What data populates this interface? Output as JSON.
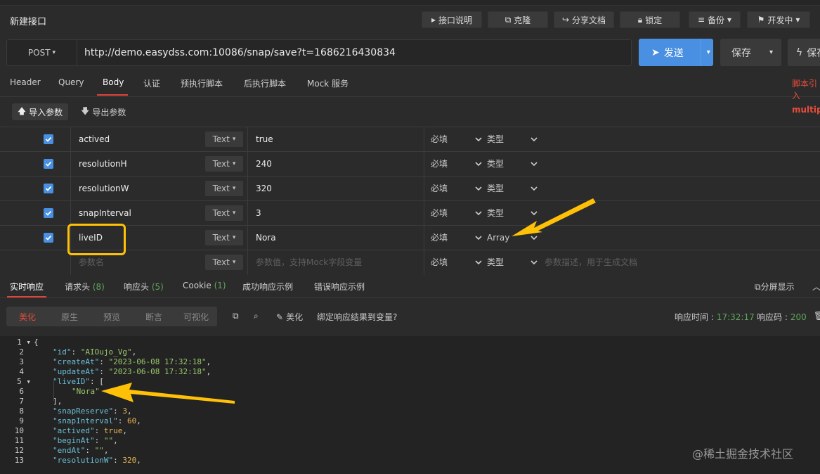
{
  "header": {
    "title": "新建接口",
    "toolbar": [
      {
        "label": "接口说明",
        "icon": "play-icon"
      },
      {
        "label": "克隆",
        "icon": "copy-icon"
      },
      {
        "label": "分享文档",
        "icon": "share-icon"
      },
      {
        "label": "锁定",
        "icon": "lock-icon"
      },
      {
        "label": "备份",
        "icon": "database-icon"
      },
      {
        "label": "开发中",
        "icon": "flag-icon"
      }
    ]
  },
  "request": {
    "method": "POST",
    "url": "http://demo.easydss.com:10086/snap/save?t=1686216430834",
    "send_label": "发送",
    "save_label": "保存",
    "save2_label": "保存"
  },
  "tabs": [
    "Header",
    "Query",
    "Body",
    "认证",
    "预执行脚本",
    "后执行脚本",
    "Mock 服务"
  ],
  "active_tab": "Body",
  "tabs_right_note": "脚本引入",
  "body": {
    "import_label": "导入参数",
    "export_label": "导出参数",
    "mode": "multipart",
    "rows": [
      {
        "name": "actived",
        "type": "Text",
        "value": "true",
        "required": "必填",
        "dtype": "类型"
      },
      {
        "name": "resolutionH",
        "type": "Text",
        "value": "240",
        "required": "必填",
        "dtype": "类型"
      },
      {
        "name": "resolutionW",
        "type": "Text",
        "value": "320",
        "required": "必填",
        "dtype": "类型"
      },
      {
        "name": "snapInterval",
        "type": "Text",
        "value": "3",
        "required": "必填",
        "dtype": "类型"
      },
      {
        "name": "liveID",
        "type": "Text",
        "value": "Nora",
        "required": "必填",
        "dtype": "Array"
      }
    ],
    "new_row": {
      "name_placeholder": "参数名",
      "type": "Text",
      "value_placeholder": "参数值，支持Mock字段变量",
      "required": "必填",
      "dtype": "类型",
      "desc_placeholder": "参数描述，用于生成文档"
    }
  },
  "response": {
    "tabs": [
      {
        "label": "实时响应",
        "count": ""
      },
      {
        "label": "请求头",
        "count": "(8)"
      },
      {
        "label": "响应头",
        "count": "(5)"
      },
      {
        "label": "Cookie",
        "count": "(1)"
      },
      {
        "label": "成功响应示例",
        "count": ""
      },
      {
        "label": "错误响应示例",
        "count": ""
      }
    ],
    "split_label": "分屏显示",
    "views": [
      "美化",
      "原生",
      "预览",
      "断言",
      "可视化"
    ],
    "active_view": "美化",
    "beautify_label": "美化",
    "bind_label": "绑定响应结果到变量?",
    "time_label": "响应时间 :",
    "time_value": "17:32:17",
    "code_label": "响应码 :",
    "code_value": "200",
    "lines": [
      "{",
      "\"id\": \"AIOujo_Vg\",",
      "\"createAt\": \"2023-06-08 17:32:18\",",
      "\"updateAt\": \"2023-06-08 17:32:18\",",
      "\"liveID\": [",
      "\"Nora\"",
      "],",
      "\"snapReserve\": 3,",
      "\"snapInterval\": 60,",
      "\"actived\": true,",
      "\"beginAt\": \"\",",
      "\"endAt\": \"\",",
      "\"resolutionW\": 320,"
    ]
  },
  "watermark": "@稀土掘金技术社区"
}
